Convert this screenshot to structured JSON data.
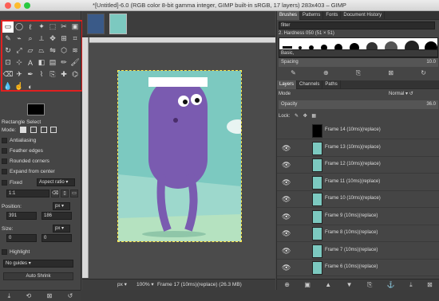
{
  "window": {
    "title": "*[Untitled]-6.0 (RGB color 8-bit gamma integer, GIMP built-in sRGB, 17 layers) 283x403 – GIMP"
  },
  "toolbox": {
    "tools": [
      {
        "icon": "rect-select-icon",
        "glyph": "▭"
      },
      {
        "icon": "ellipse-select-icon",
        "glyph": "◯"
      },
      {
        "icon": "lasso-icon",
        "glyph": "ℓ"
      },
      {
        "icon": "fuzzy-select-icon",
        "glyph": "✦"
      },
      {
        "icon": "color-select-icon",
        "glyph": "⬚"
      },
      {
        "icon": "scissors-icon",
        "glyph": "✂"
      },
      {
        "icon": "foreground-select-icon",
        "glyph": "▣"
      },
      {
        "icon": "paths-icon",
        "glyph": "✎"
      },
      {
        "icon": "color-picker-icon",
        "glyph": "⌁"
      },
      {
        "icon": "zoom-icon",
        "glyph": "⌕"
      },
      {
        "icon": "measure-icon",
        "glyph": "⟂"
      },
      {
        "icon": "move-icon",
        "glyph": "✥"
      },
      {
        "icon": "align-icon",
        "glyph": "⊞"
      },
      {
        "icon": "crop-icon",
        "glyph": "⌗"
      },
      {
        "icon": "rotate-icon",
        "glyph": "↻"
      },
      {
        "icon": "scale-icon",
        "glyph": "⤢"
      },
      {
        "icon": "shear-icon",
        "glyph": "▱"
      },
      {
        "icon": "perspective-icon",
        "glyph": "⏢"
      },
      {
        "icon": "flip-icon",
        "glyph": "⇋"
      },
      {
        "icon": "cage-icon",
        "glyph": "⬡"
      },
      {
        "icon": "warp-icon",
        "glyph": "≋"
      },
      {
        "icon": "unified-transform-icon",
        "glyph": "⊡"
      },
      {
        "icon": "handle-transform-icon",
        "glyph": "⊹"
      },
      {
        "icon": "text-icon",
        "glyph": "A"
      },
      {
        "icon": "bucket-fill-icon",
        "glyph": "◧"
      },
      {
        "icon": "gradient-icon",
        "glyph": "▤"
      },
      {
        "icon": "pencil-icon",
        "glyph": "✏"
      },
      {
        "icon": "paintbrush-icon",
        "glyph": "🖌"
      },
      {
        "icon": "eraser-icon",
        "glyph": "⌫"
      },
      {
        "icon": "airbrush-icon",
        "glyph": "✈"
      },
      {
        "icon": "ink-icon",
        "glyph": "✒"
      },
      {
        "icon": "mypaint-icon",
        "glyph": "⌇"
      },
      {
        "icon": "clone-icon",
        "glyph": "⎘"
      },
      {
        "icon": "heal-icon",
        "glyph": "✚"
      },
      {
        "icon": "perspective-clone-icon",
        "glyph": "⌬"
      },
      {
        "icon": "blur-icon",
        "glyph": "💧"
      },
      {
        "icon": "smudge-icon",
        "glyph": "☝"
      },
      {
        "icon": "dodge-burn-icon",
        "glyph": "◐"
      }
    ],
    "options": {
      "title": "Rectangle Select",
      "mode_label": "Mode:",
      "antialiasing": "Antialiasing",
      "feather": "Feather edges",
      "rounded": "Rounded corners",
      "expand": "Expand from center",
      "fixed": "Fixed",
      "aspect": "Aspect ratio",
      "ratio": "1:1",
      "position_label": "Position:",
      "pos_unit": "px",
      "pos_x": "391",
      "pos_y": "186",
      "size_label": "Size:",
      "size_unit": "px",
      "size_w": "0",
      "size_h": "0",
      "highlight": "Highlight",
      "guides": "No guides",
      "autoshrink": "Auto Shrink"
    }
  },
  "status": {
    "unit": "px",
    "zoom": "100%",
    "text": "Frame 17 (10ms)(replace) (26.3 MB)"
  },
  "dock": {
    "tabs_top": [
      "Brushes",
      "Patterns",
      "Fonts",
      "Document History"
    ],
    "filter_placeholder": "filter",
    "brush_name": "2. Hardness 050 (51 × 51)",
    "preset": "Basic,",
    "spacing_label": "Spacing",
    "spacing_value": "10.0",
    "tabs_layers": [
      "Layers",
      "Channels",
      "Paths"
    ],
    "mode_label": "Mode",
    "mode_value": "Normal",
    "opacity_label": "Opacity",
    "opacity_value": "36.0",
    "lock_label": "Lock:",
    "layers": [
      {
        "name": "Frame 14 (10ms)(replace)",
        "visible": false,
        "black": true
      },
      {
        "name": "Frame 13 (10ms)(replace)",
        "visible": true
      },
      {
        "name": "Frame 12 (10ms)(replace)",
        "visible": true
      },
      {
        "name": "Frame 11 (10ms)(replace)",
        "visible": true
      },
      {
        "name": "Frame 10 (10ms)(replace)",
        "visible": true
      },
      {
        "name": "Frame 9 (10ms)(replace)",
        "visible": true
      },
      {
        "name": "Frame 8 (10ms)(replace)",
        "visible": true
      },
      {
        "name": "Frame 7 (10ms)(replace)",
        "visible": true
      },
      {
        "name": "Frame 6 (10ms)(replace)",
        "visible": true
      }
    ]
  },
  "colors": {
    "accent": "#e02020",
    "canvas_bg": "#7cc9c0",
    "character": "#7a5bb0"
  }
}
